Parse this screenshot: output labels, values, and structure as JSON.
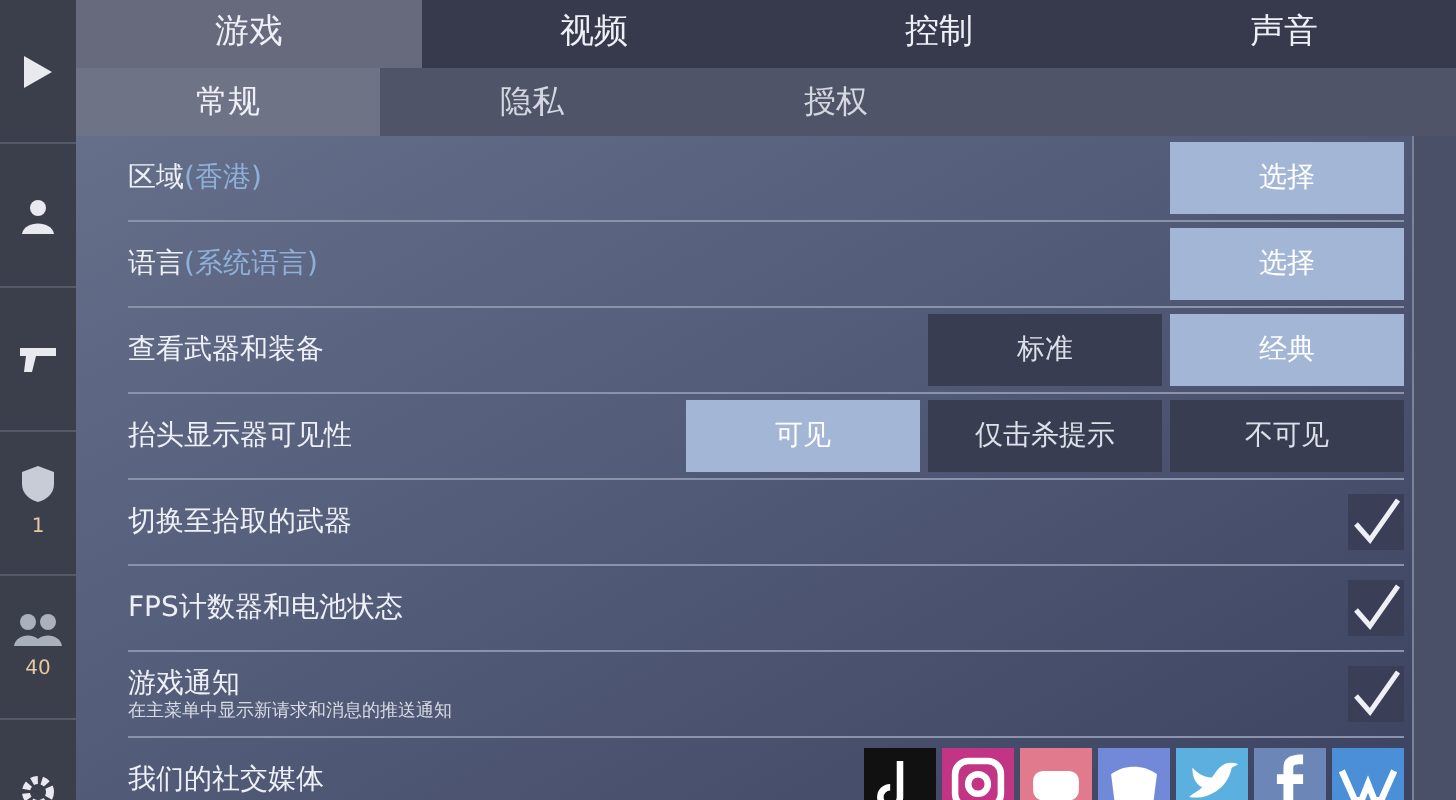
{
  "sidebar": {
    "items": [
      {
        "kind": "play"
      },
      {
        "kind": "person"
      },
      {
        "kind": "gun"
      },
      {
        "kind": "shield",
        "count": "1"
      },
      {
        "kind": "group",
        "count": "40"
      },
      {
        "kind": "gear"
      }
    ]
  },
  "tabs": [
    {
      "label": "游戏",
      "selected": true
    },
    {
      "label": "视频",
      "selected": false
    },
    {
      "label": "控制",
      "selected": false
    },
    {
      "label": "声音",
      "selected": false
    }
  ],
  "subtabs": [
    {
      "label": "常规",
      "selected": true
    },
    {
      "label": "隐私",
      "selected": false
    },
    {
      "label": "授权",
      "selected": false
    }
  ],
  "rows": [
    {
      "kind": "button",
      "label": "区域",
      "value": "(香港)",
      "button": "选择"
    },
    {
      "kind": "button",
      "label": "语言",
      "value": "(系统语言)",
      "button": "选择"
    },
    {
      "kind": "options",
      "label": "查看武器和装备",
      "options": [
        {
          "label": "标准",
          "selected": false
        },
        {
          "label": "经典",
          "selected": true
        }
      ]
    },
    {
      "kind": "options",
      "label": "抬头显示器可见性",
      "options": [
        {
          "label": "可见",
          "selected": true
        },
        {
          "label": "仅击杀提示",
          "selected": false
        },
        {
          "label": "不可见",
          "selected": false
        }
      ]
    },
    {
      "kind": "check",
      "label": "切换至拾取的武器",
      "checked": true
    },
    {
      "kind": "check",
      "label": "FPS计数器和电池状态",
      "checked": true
    },
    {
      "kind": "check",
      "label": "游戏通知",
      "note": "在主菜单中显示新请求和消息的推送通知",
      "checked": true
    },
    {
      "kind": "social",
      "label": "我们的社交媒体",
      "links": [
        {
          "kind": "tiktok",
          "color": "#111111"
        },
        {
          "kind": "instagram",
          "color": "#c13584"
        },
        {
          "kind": "youtube",
          "color": "#e07a8c"
        },
        {
          "kind": "discord",
          "color": "#7289da"
        },
        {
          "kind": "twitter",
          "color": "#5bb0e0"
        },
        {
          "kind": "facebook",
          "color": "#6d86b8"
        },
        {
          "kind": "vk",
          "color": "#4a8fd8"
        }
      ]
    }
  ]
}
